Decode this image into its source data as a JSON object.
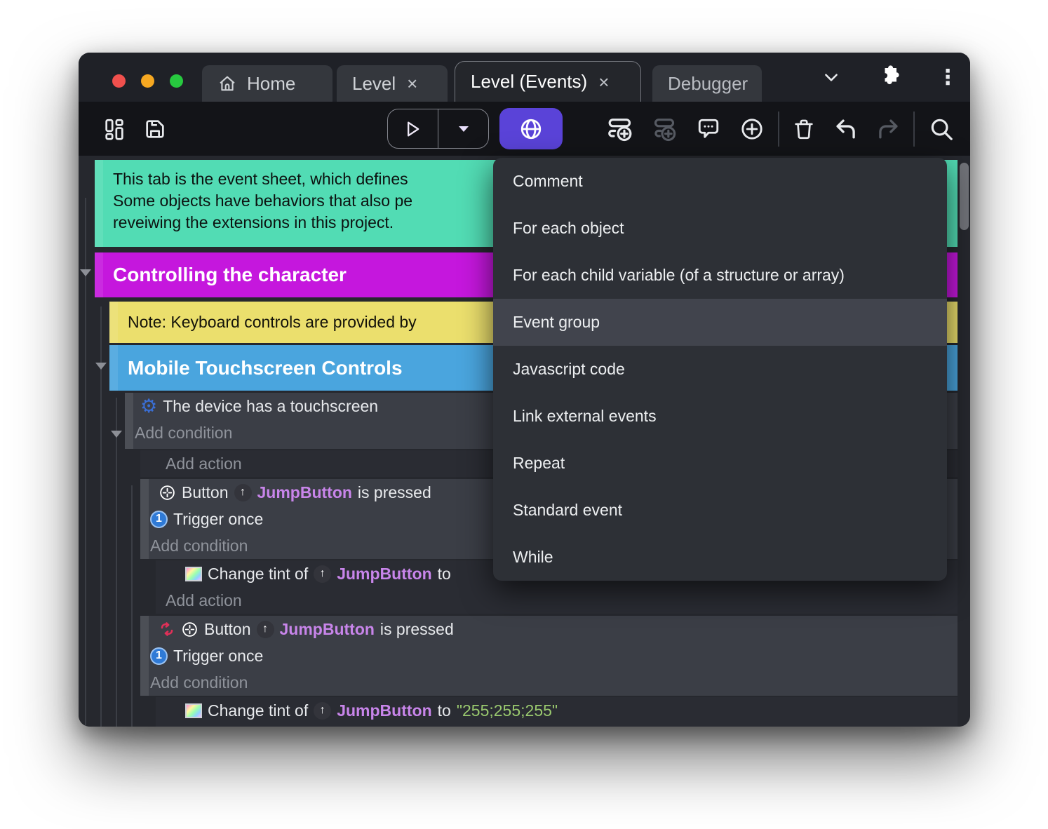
{
  "tabs": {
    "home": "Home",
    "level": "Level",
    "level_events": "Level (Events)",
    "debugger": "Debugger",
    "close_glyph": "×"
  },
  "menu": {
    "highlighted": "Event group",
    "items": [
      {
        "label": "Comment"
      },
      {
        "label": "For each object"
      },
      {
        "label": "For each child variable (of a structure or array)"
      },
      {
        "label": "Event group"
      },
      {
        "label": "Javascript code"
      },
      {
        "label": "Link external events"
      },
      {
        "label": "Repeat"
      },
      {
        "label": "Standard event"
      },
      {
        "label": "While"
      }
    ]
  },
  "sheet": {
    "comment": {
      "line1": "This tab is the event sheet, which defines",
      "line2": "Some objects have behaviors that also pe",
      "line3": "reveiwing the extensions in this project."
    },
    "group_controlling": "Controlling the character",
    "note_keyboard": "Note: Keyboard controls are provided by",
    "group_mobile": "Mobile Touchscreen Controls",
    "touchscreen_condition": "The device has a touchscreen",
    "add_condition": "Add condition",
    "add_action": "Add action",
    "button_word": "Button",
    "object_name": "JumpButton",
    "is_pressed": "is pressed",
    "trigger_once": "Trigger once",
    "change_tint_of": "Change tint of",
    "to_word": "to",
    "tint_value": "\"255;255;255\""
  },
  "icons": {
    "gear_glyph": "⚙",
    "up_arrow_glyph": "↑",
    "one_glyph": "1",
    "kebab_glyph": "⋮"
  },
  "colors": {
    "accent_purple": "#5a43d8",
    "comment_teal": "#52dcb4",
    "group_magenta": "#c517dd",
    "note_yellow": "#ebdf6d",
    "group_blue": "#4aa5de",
    "object_purple": "#c885ea",
    "string_green": "#9ac96f"
  }
}
